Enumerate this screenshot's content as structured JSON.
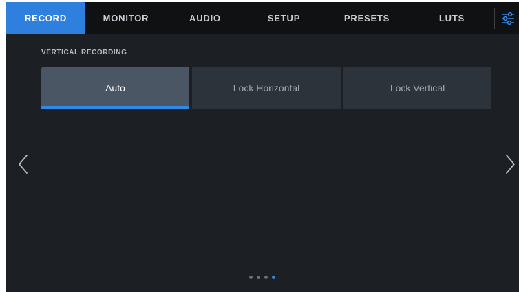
{
  "tabs": [
    {
      "label": "RECORD",
      "active": true
    },
    {
      "label": "MONITOR",
      "active": false
    },
    {
      "label": "AUDIO",
      "active": false
    },
    {
      "label": "SETUP",
      "active": false
    },
    {
      "label": "PRESETS",
      "active": false
    },
    {
      "label": "LUTS",
      "active": false
    }
  ],
  "settings_icon": "sliders-icon",
  "vertical_recording": {
    "label": "VERTICAL RECORDING",
    "options": [
      {
        "label": "Auto",
        "selected": true
      },
      {
        "label": "Lock Horizontal",
        "selected": false
      },
      {
        "label": "Lock Vertical",
        "selected": false
      }
    ]
  },
  "navigation": {
    "prev_icon": "chevron-left-icon",
    "next_icon": "chevron-right-icon"
  },
  "pagination": {
    "page_count": 4,
    "current_page": 4
  },
  "colors": {
    "accent": "#2e7fde",
    "background": "#1c1f23",
    "tabbar": "#0f1113"
  }
}
